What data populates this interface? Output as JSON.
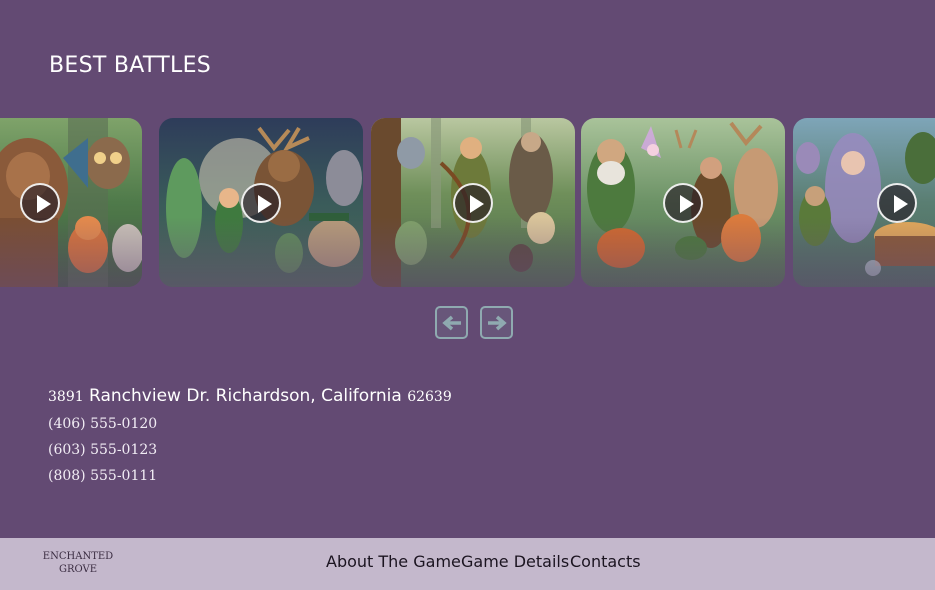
{
  "section": {
    "title": "BEST BATTLES"
  },
  "carousel": {
    "cards": [
      {
        "label": "",
        "scene": "tree-creature-owl-fox"
      },
      {
        "label": "",
        "scene": "dryad-stag-elf"
      },
      {
        "label": "",
        "scene": "archer-forest-spirits"
      },
      {
        "label": "",
        "scene": "wizard-fox-ranger"
      },
      {
        "label": "",
        "scene": "fairy-tree-stump-glade"
      }
    ],
    "prev_icon": "arrow-left-icon",
    "next_icon": "arrow-right-icon"
  },
  "contact": {
    "address_number": "3891",
    "address_street": "Ranchview Dr. Richardson, California",
    "address_zip": "62639",
    "phones": [
      "(406) 555-0120",
      "(603) 555-0123",
      "(808) 555-0111"
    ]
  },
  "footer": {
    "logo_line1": "ENCHANTED",
    "logo_line2": "GROVE",
    "nav": [
      "About The Game",
      "Game Details",
      "Contacts"
    ]
  },
  "colors": {
    "background": "#634a73",
    "footer": "#c4b8cc",
    "nav_button_border": "#8faab0"
  }
}
